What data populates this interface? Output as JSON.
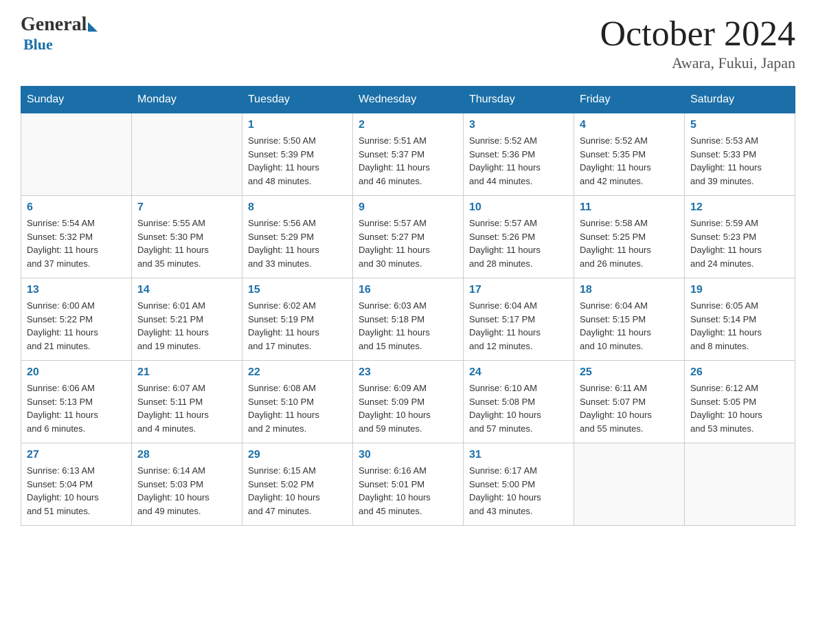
{
  "header": {
    "logo": {
      "general": "General",
      "blue": "Blue"
    },
    "title": "October 2024",
    "location": "Awara, Fukui, Japan"
  },
  "days_of_week": [
    "Sunday",
    "Monday",
    "Tuesday",
    "Wednesday",
    "Thursday",
    "Friday",
    "Saturday"
  ],
  "weeks": [
    [
      {
        "day": "",
        "info": ""
      },
      {
        "day": "",
        "info": ""
      },
      {
        "day": "1",
        "info": "Sunrise: 5:50 AM\nSunset: 5:39 PM\nDaylight: 11 hours\nand 48 minutes."
      },
      {
        "day": "2",
        "info": "Sunrise: 5:51 AM\nSunset: 5:37 PM\nDaylight: 11 hours\nand 46 minutes."
      },
      {
        "day": "3",
        "info": "Sunrise: 5:52 AM\nSunset: 5:36 PM\nDaylight: 11 hours\nand 44 minutes."
      },
      {
        "day": "4",
        "info": "Sunrise: 5:52 AM\nSunset: 5:35 PM\nDaylight: 11 hours\nand 42 minutes."
      },
      {
        "day": "5",
        "info": "Sunrise: 5:53 AM\nSunset: 5:33 PM\nDaylight: 11 hours\nand 39 minutes."
      }
    ],
    [
      {
        "day": "6",
        "info": "Sunrise: 5:54 AM\nSunset: 5:32 PM\nDaylight: 11 hours\nand 37 minutes."
      },
      {
        "day": "7",
        "info": "Sunrise: 5:55 AM\nSunset: 5:30 PM\nDaylight: 11 hours\nand 35 minutes."
      },
      {
        "day": "8",
        "info": "Sunrise: 5:56 AM\nSunset: 5:29 PM\nDaylight: 11 hours\nand 33 minutes."
      },
      {
        "day": "9",
        "info": "Sunrise: 5:57 AM\nSunset: 5:27 PM\nDaylight: 11 hours\nand 30 minutes."
      },
      {
        "day": "10",
        "info": "Sunrise: 5:57 AM\nSunset: 5:26 PM\nDaylight: 11 hours\nand 28 minutes."
      },
      {
        "day": "11",
        "info": "Sunrise: 5:58 AM\nSunset: 5:25 PM\nDaylight: 11 hours\nand 26 minutes."
      },
      {
        "day": "12",
        "info": "Sunrise: 5:59 AM\nSunset: 5:23 PM\nDaylight: 11 hours\nand 24 minutes."
      }
    ],
    [
      {
        "day": "13",
        "info": "Sunrise: 6:00 AM\nSunset: 5:22 PM\nDaylight: 11 hours\nand 21 minutes."
      },
      {
        "day": "14",
        "info": "Sunrise: 6:01 AM\nSunset: 5:21 PM\nDaylight: 11 hours\nand 19 minutes."
      },
      {
        "day": "15",
        "info": "Sunrise: 6:02 AM\nSunset: 5:19 PM\nDaylight: 11 hours\nand 17 minutes."
      },
      {
        "day": "16",
        "info": "Sunrise: 6:03 AM\nSunset: 5:18 PM\nDaylight: 11 hours\nand 15 minutes."
      },
      {
        "day": "17",
        "info": "Sunrise: 6:04 AM\nSunset: 5:17 PM\nDaylight: 11 hours\nand 12 minutes."
      },
      {
        "day": "18",
        "info": "Sunrise: 6:04 AM\nSunset: 5:15 PM\nDaylight: 11 hours\nand 10 minutes."
      },
      {
        "day": "19",
        "info": "Sunrise: 6:05 AM\nSunset: 5:14 PM\nDaylight: 11 hours\nand 8 minutes."
      }
    ],
    [
      {
        "day": "20",
        "info": "Sunrise: 6:06 AM\nSunset: 5:13 PM\nDaylight: 11 hours\nand 6 minutes."
      },
      {
        "day": "21",
        "info": "Sunrise: 6:07 AM\nSunset: 5:11 PM\nDaylight: 11 hours\nand 4 minutes."
      },
      {
        "day": "22",
        "info": "Sunrise: 6:08 AM\nSunset: 5:10 PM\nDaylight: 11 hours\nand 2 minutes."
      },
      {
        "day": "23",
        "info": "Sunrise: 6:09 AM\nSunset: 5:09 PM\nDaylight: 10 hours\nand 59 minutes."
      },
      {
        "day": "24",
        "info": "Sunrise: 6:10 AM\nSunset: 5:08 PM\nDaylight: 10 hours\nand 57 minutes."
      },
      {
        "day": "25",
        "info": "Sunrise: 6:11 AM\nSunset: 5:07 PM\nDaylight: 10 hours\nand 55 minutes."
      },
      {
        "day": "26",
        "info": "Sunrise: 6:12 AM\nSunset: 5:05 PM\nDaylight: 10 hours\nand 53 minutes."
      }
    ],
    [
      {
        "day": "27",
        "info": "Sunrise: 6:13 AM\nSunset: 5:04 PM\nDaylight: 10 hours\nand 51 minutes."
      },
      {
        "day": "28",
        "info": "Sunrise: 6:14 AM\nSunset: 5:03 PM\nDaylight: 10 hours\nand 49 minutes."
      },
      {
        "day": "29",
        "info": "Sunrise: 6:15 AM\nSunset: 5:02 PM\nDaylight: 10 hours\nand 47 minutes."
      },
      {
        "day": "30",
        "info": "Sunrise: 6:16 AM\nSunset: 5:01 PM\nDaylight: 10 hours\nand 45 minutes."
      },
      {
        "day": "31",
        "info": "Sunrise: 6:17 AM\nSunset: 5:00 PM\nDaylight: 10 hours\nand 43 minutes."
      },
      {
        "day": "",
        "info": ""
      },
      {
        "day": "",
        "info": ""
      }
    ]
  ]
}
